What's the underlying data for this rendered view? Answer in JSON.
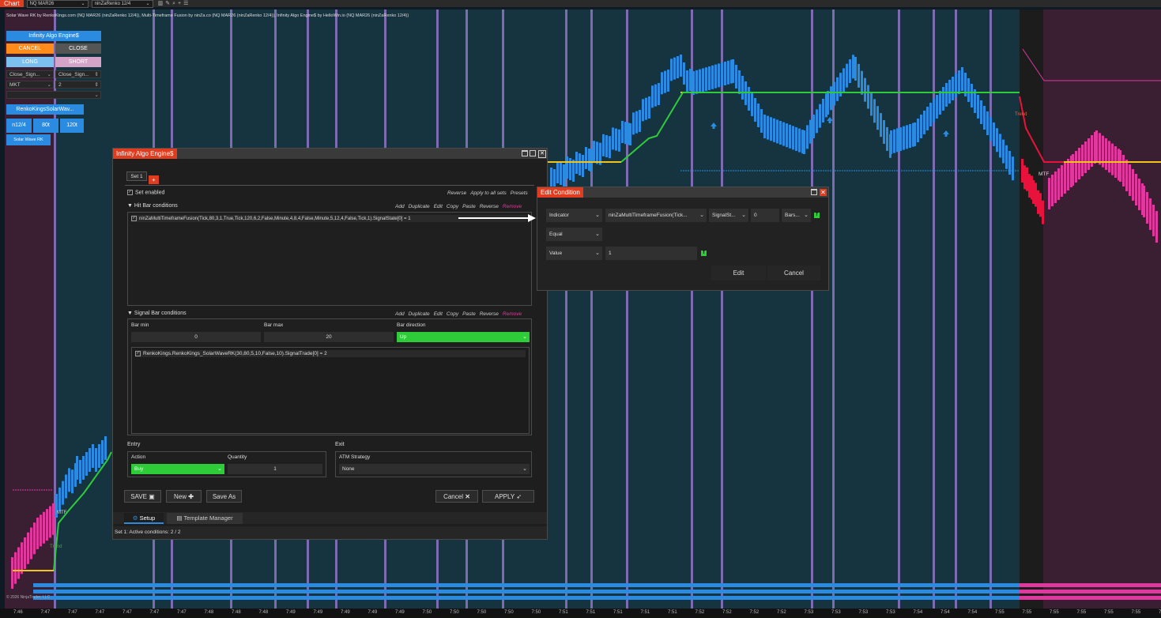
{
  "topbar": {
    "chart_tab": "Chart",
    "instrument": "NQ MAR26",
    "bar_type": "ninZaRenko 12/4",
    "icons": [
      "bar-type-icon",
      "drawing-tool-icon",
      "zoom-icon",
      "crosshair-icon",
      "properties-icon"
    ]
  },
  "chart": {
    "title": "Solar Wave RK by RenkoKings.com (NQ MAR26 (ninZaRenko 12/4)), Multi-Timeframe Fusion by ninZa.co (NQ MAR26 (ninZaRenko 12/4)), Infinity Algo Engine$ by HelloWin.io (NQ MAR26 (ninZaRenko 12/4))",
    "copyright": "© 2026 NinjaTrader, LLC",
    "labels": {
      "trend1": "Trend",
      "trend2": "Trend",
      "mtf1": "MTF",
      "mtf2": "MTF"
    },
    "x_ticks": [
      "7:46",
      "7:47",
      "7:47",
      "7:47",
      "7:47",
      "7:47",
      "7:47",
      "7:48",
      "7:48",
      "7:48",
      "7:49",
      "7:49",
      "7:49",
      "7:49",
      "7:49",
      "7:50",
      "7:50",
      "7:50",
      "7:50",
      "7:50",
      "7:51",
      "7:51",
      "7:51",
      "7:51",
      "7:51",
      "7:52",
      "7:52",
      "7:52",
      "7:52",
      "7:53",
      "7:53",
      "7:53",
      "7:53",
      "7:54",
      "7:54",
      "7:54",
      "7:55",
      "7:55",
      "7:55",
      "7:55",
      "7:55",
      "7:55",
      "7:55"
    ],
    "colors": {
      "background": "#163440",
      "uptrend": "#2fcc3a",
      "baseline": "#f0c419",
      "downtrend": "#e8123c",
      "bars_up": "#2a8be0",
      "bars_down": "#e0389e"
    }
  },
  "trade_panel": {
    "title": "Infinity Algo Engine$",
    "cancel": "CANCEL",
    "close": "CLOSE",
    "long": "LONG",
    "short": "SHORT",
    "close_signal_1": "Close_Sign...",
    "close_signal_2": "Close_Sign...",
    "order_type": "MKT",
    "quantity": "2",
    "renko_btn": "RenkoKingsSolarWav...",
    "n12": "n12/4",
    "t80": "80t",
    "t120": "120t",
    "solar_btn": "Solar Wave RK"
  },
  "engine_window": {
    "title": "Infinity Algo Engine$",
    "tab_set": "Set 1",
    "tab_add": "+",
    "set_enabled": "Set enabled",
    "top_actions": [
      "Reverse",
      "Apply to all sets",
      "Presets"
    ],
    "hit_bar_header": "Hit Bar conditions",
    "condition_actions": [
      "Add",
      "Duplicate",
      "Edit",
      "Copy",
      "Paste",
      "Reverse",
      "Remove"
    ],
    "hit_condition": "ninZaMultiTimeframeFusion(Tick,80,3,1,True,Tick,120,6,2,False,Minute,4,8,4,False,Minute,5,12,4,False,Tick,1).SignalState[0] = 1",
    "signal_bar_header": "Signal Bar conditions",
    "bar_min_label": "Bar min",
    "bar_max_label": "Bar max",
    "bar_direction_label": "Bar direction",
    "bar_min": "0",
    "bar_max": "20",
    "bar_direction": "Up",
    "signal_condition": "RenkoKings.RenkoKings_SolarWaveRK(30,80,5,10,False,10).SignalTrade[0] = 2",
    "entry_label": "Entry",
    "exit_label": "Exit",
    "action_label": "Action",
    "quantity_label": "Quantity",
    "atm_label": "ATM Strategy",
    "action": "Buy",
    "quantity": "1",
    "atm": "None",
    "save": "SAVE",
    "new": "New",
    "save_as": "Save As",
    "cancel": "Cancel",
    "apply": "APPLY",
    "tab_setup": "Setup",
    "tab_template": "Template Manager",
    "status": "Set 1:  Active conditions: 2 / 2"
  },
  "edit_condition": {
    "title": "Edit Condition",
    "left_type": "Indicator",
    "indicator": "ninZaMultiTimeframeFusion(Tick...",
    "plot": "SignalSt...",
    "bars_ago": "0",
    "bars": "Bars...",
    "operator": "Equal",
    "right_type": "Value",
    "value": "1",
    "edit": "Edit",
    "cancel": "Cancel"
  }
}
